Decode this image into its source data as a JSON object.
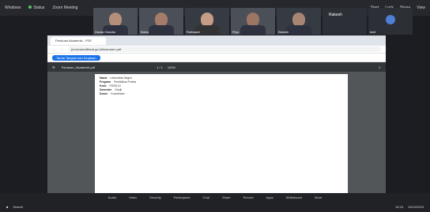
{
  "zoom": {
    "menu": "Windows",
    "status": "Status",
    "title": "Zoom Meeting",
    "right": [
      "Start",
      "Lock",
      "Share",
      "View"
    ]
  },
  "participants": [
    {
      "name": "Gaurav Chandra"
    },
    {
      "name": "Sneha"
    },
    {
      "name": "Participant"
    },
    {
      "name": "Priya"
    },
    {
      "name": "Ramesh"
    },
    {
      "name": "Rakesh"
    },
    {
      "name": "Amit"
    }
  ],
  "browser": {
    "tab_label": "Panduan Akademik - PDF",
    "url": "jrs.kemendikbud.go.id/dokumen.pdf",
    "bookmark_btn": "Tanda Tangani dan Kerjakan"
  },
  "pdf": {
    "title": "Panduan_Akademik.pdf",
    "page_count": "1 / 1",
    "zoom": "100%",
    "lines": [
      {
        "label": "Nama",
        "text": "Universitas Negeri"
      },
      {
        "label": "Program",
        "text": "Pendidikan Profesi"
      },
      {
        "label": "Kode",
        "text": "PGSD-01"
      },
      {
        "label": "Semester",
        "text": "Ganjil"
      },
      {
        "label": "Dosen",
        "text": "Koordinator"
      }
    ]
  },
  "zoomctl": [
    "Audio",
    "Video",
    "Security",
    "Participants",
    "Chat",
    "Share",
    "Record",
    "Apps",
    "Whiteboard",
    "More"
  ],
  "taskbar": {
    "search": "Search",
    "time": "10:24",
    "date": "10/10/2023"
  }
}
